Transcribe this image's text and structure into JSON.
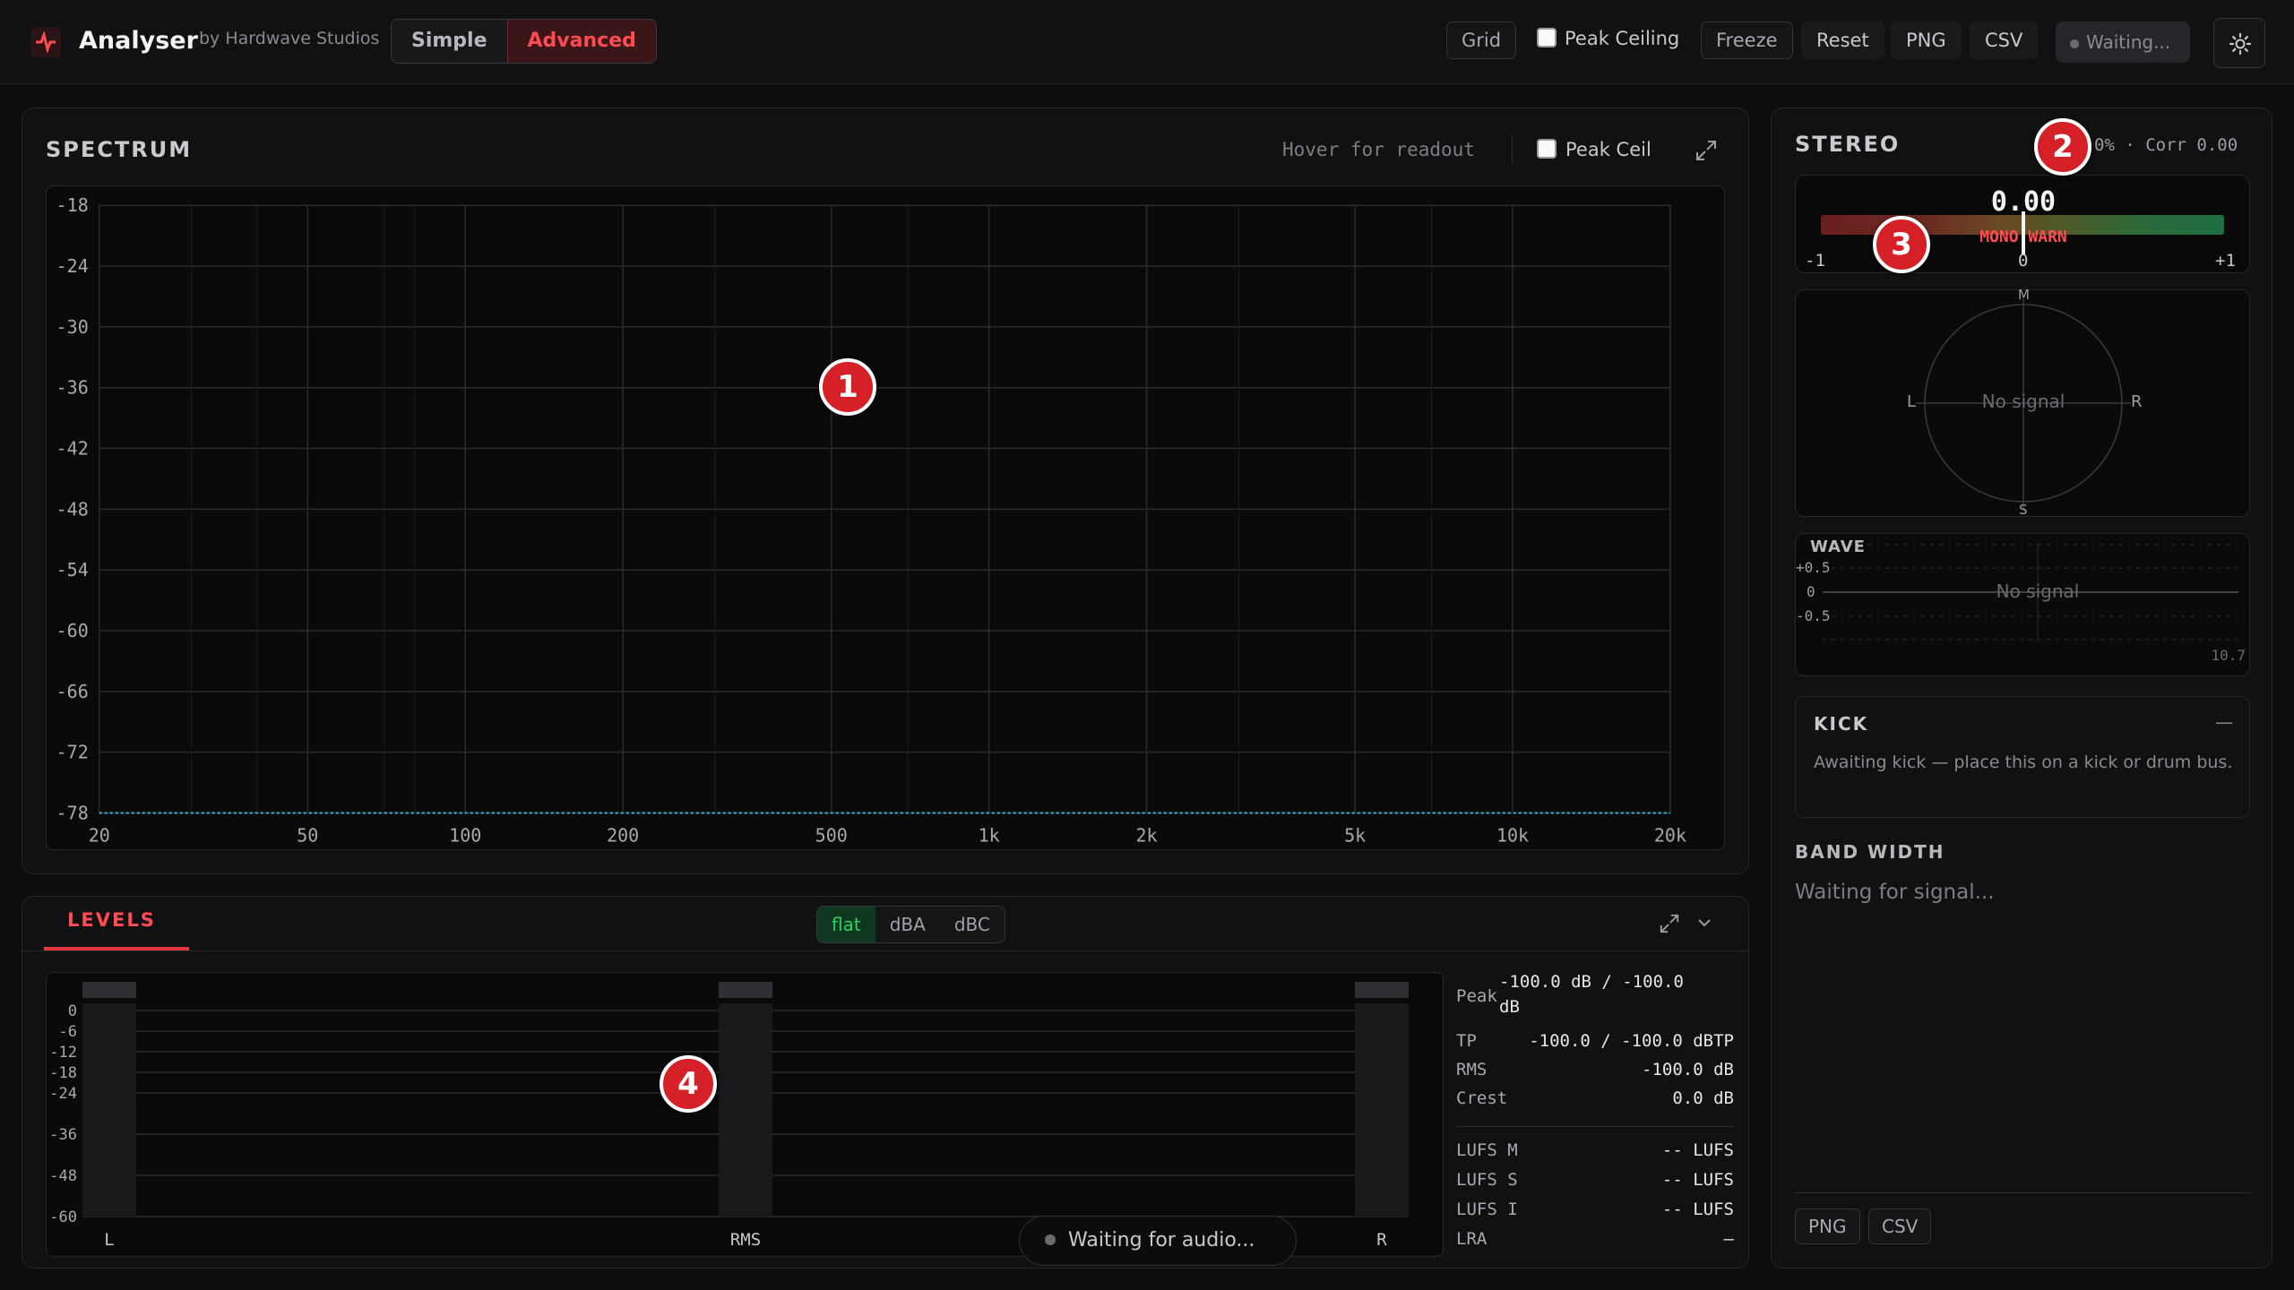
{
  "app": {
    "title": "Analyser",
    "byline": "by Hardwave Studios",
    "modes": [
      "Simple",
      "Advanced"
    ],
    "active_mode": "Advanced"
  },
  "toolbar": {
    "grid": "Grid",
    "peak_ceiling": "Peak Ceiling",
    "freeze": "Freeze",
    "reset": "Reset",
    "png": "PNG",
    "csv": "CSV",
    "status": "Waiting..."
  },
  "spectrum": {
    "title": "SPECTRUM",
    "hover": "Hover for readout",
    "peak_ceil": "Peak Ceil",
    "y_ticks": [
      "-18",
      "-24",
      "-30",
      "-36",
      "-42",
      "-48",
      "-54",
      "-60",
      "-66",
      "-72",
      "-78"
    ],
    "x_ticks": [
      "20",
      "50",
      "100",
      "200",
      "500",
      "1k",
      "2k",
      "5k",
      "10k",
      "20k"
    ],
    "line_color": "#38b6d8"
  },
  "levels": {
    "tab": "LEVELS",
    "weightings": [
      "flat",
      "dBA",
      "dBC"
    ],
    "active_weighting": "flat",
    "scale": [
      "0",
      "-6",
      "-12",
      "-18",
      "-24",
      "-36",
      "-48",
      "-60"
    ],
    "meters": [
      "L",
      "RMS",
      "R"
    ],
    "waiting": "Waiting for audio...",
    "stats": {
      "peak_label": "Peak",
      "peak_val_1": "-100.0 dB / -100.0",
      "peak_val_2": "dB",
      "tp_label": "TP",
      "tp_val": "-100.0 / -100.0 dBTP",
      "rms_label": "RMS",
      "rms_val": "-100.0 dB",
      "crest_label": "Crest",
      "crest_val": "0.0 dB",
      "lufs_m_label": "LUFS M",
      "lufs_m_val": "-- LUFS",
      "lufs_s_label": "LUFS S",
      "lufs_s_val": "-- LUFS",
      "lufs_i_label": "LUFS I",
      "lufs_i_val": "-- LUFS",
      "lra_label": "LRA",
      "lra_val": "—"
    }
  },
  "stereo": {
    "title": "STEREO",
    "readout": "0% · Corr 0.00",
    "corr_value": "0.00",
    "mono_warn": "MONO WARN",
    "corr_ticks": [
      "-1",
      "0",
      "+1"
    ],
    "scope": {
      "m": "M",
      "s": "S",
      "l": "L",
      "r": "R",
      "no_signal": "No signal"
    },
    "wave": {
      "title": "WAVE",
      "ticks": [
        "+0.5",
        "0",
        "-0.5"
      ],
      "no_signal": "No signal",
      "time": "10.7"
    },
    "kick": {
      "title": "KICK",
      "dash": "—",
      "text": "Awaiting kick — place this on a kick or drum bus."
    },
    "band_title": "BAND WIDTH",
    "band_text": "Waiting for signal...",
    "png": "PNG",
    "csv": "CSV"
  },
  "markers": [
    "1",
    "2",
    "3",
    "4"
  ],
  "colors": {
    "accent": "#ff4b52",
    "active_green": "#2ad15e",
    "marker": "#d42026"
  }
}
